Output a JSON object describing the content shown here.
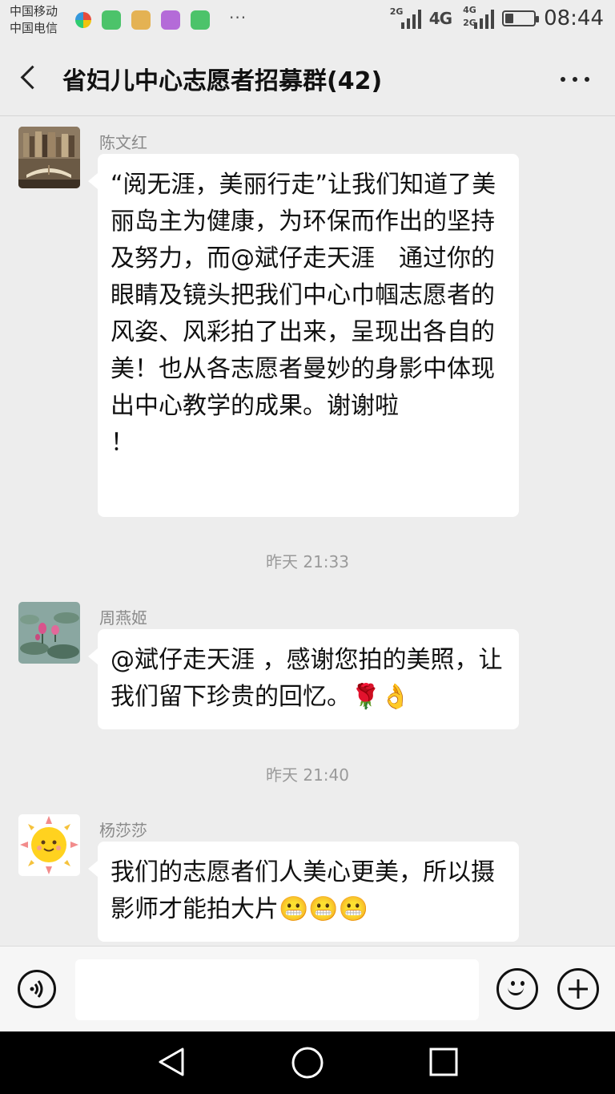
{
  "status_bar": {
    "carrier_1": "中国移动",
    "carrier_2": "中国电信",
    "more": "···",
    "net_1": "2G",
    "net_2": "4G",
    "net_3a": "4G",
    "net_3b": "2G",
    "time": "08:44",
    "battery_level": 0.3,
    "app_icon_colors": [
      "#ffffff",
      "#4cc36a",
      "#e4b253",
      "#b46bd8",
      "#4cc36a"
    ]
  },
  "header": {
    "title": "省妇儿中心志愿者招募群(42)"
  },
  "messages": [
    {
      "sender": "陈文红",
      "avatar": "books-avatar",
      "text": "“阅无涯，美丽行走”让我们知道了美丽岛主为健康，为环保而作出的坚持及努力，而@斌仔走天涯　通过你的眼睛及镜头把我们中心巾帼志愿者的风姿、风彩拍了出来，呈现出各自的美！也从各志愿者曼妙的身影中体现出中心教学的成果。谢谢啦\n！"
    },
    {
      "timestamp": "昨天 21:33"
    },
    {
      "sender": "周燕姬",
      "avatar": "lotus-avatar",
      "text": "@斌仔走天涯 ，感谢您拍的美照，让我们留下珍贵的回忆。🌹👌"
    },
    {
      "timestamp": "昨天 21:40"
    },
    {
      "sender": "杨莎莎",
      "avatar": "sun-avatar",
      "text": "我们的志愿者们人美心更美，所以摄影师才能拍大片😬😬😬"
    }
  ],
  "input_bar": {
    "voice_icon": "voice-icon",
    "emoji_icon": "emoji-icon",
    "plus_icon": "plus-icon",
    "input_value": ""
  },
  "nav_bar": {
    "back_icon": "triangle-back-icon",
    "home_icon": "circle-home-icon",
    "recents_icon": "square-recents-icon"
  },
  "colors": {
    "background": "#ededed",
    "bubble": "#ffffff",
    "meta_text": "#9a9a9a"
  }
}
